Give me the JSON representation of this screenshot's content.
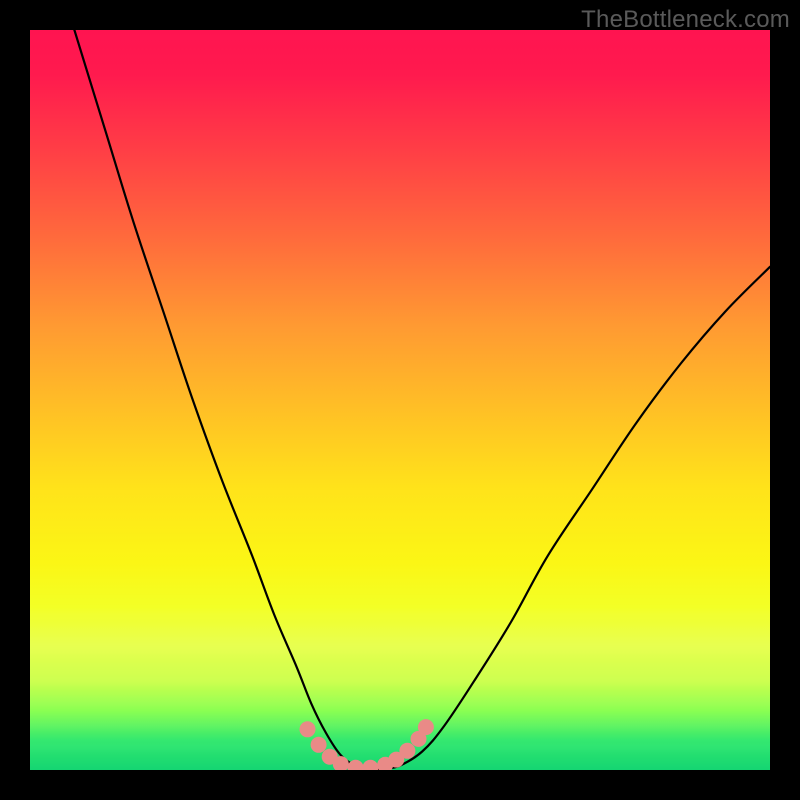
{
  "watermark": "TheBottleneck.com",
  "chart_data": {
    "type": "line",
    "title": "",
    "xlabel": "",
    "ylabel": "",
    "xlim": [
      0,
      100
    ],
    "ylim": [
      0,
      100
    ],
    "grid": false,
    "legend": false,
    "background_gradient": {
      "direction": "vertical",
      "stops": [
        {
          "pos": 0.0,
          "color": "#ff1450"
        },
        {
          "pos": 0.5,
          "color": "#ffc225"
        },
        {
          "pos": 0.78,
          "color": "#f3ff26"
        },
        {
          "pos": 0.92,
          "color": "#8aff52"
        },
        {
          "pos": 1.0,
          "color": "#15d572"
        }
      ]
    },
    "series": [
      {
        "name": "bottleneck-curve",
        "color": "#000000",
        "line_width": 2,
        "x": [
          6,
          10,
          14,
          18,
          22,
          26,
          30,
          33,
          36,
          38,
          40,
          42,
          44,
          46,
          48,
          50,
          53,
          56,
          60,
          65,
          70,
          76,
          82,
          88,
          94,
          100
        ],
        "y": [
          100,
          87,
          74,
          62,
          50,
          39,
          29,
          21,
          14,
          9,
          5,
          2,
          0.6,
          0.2,
          0.2,
          0.6,
          2.5,
          6,
          12,
          20,
          29,
          38,
          47,
          55,
          62,
          68
        ]
      },
      {
        "name": "low-region-markers",
        "color": "#e98a87",
        "marker_size": 16,
        "type": "scatter",
        "x": [
          37.5,
          39,
          40.5,
          42,
          44,
          46,
          48,
          49.5,
          51,
          52.5,
          53.5
        ],
        "y": [
          5.5,
          3.4,
          1.8,
          0.8,
          0.3,
          0.3,
          0.7,
          1.4,
          2.6,
          4.2,
          5.8
        ]
      }
    ],
    "annotations": []
  }
}
